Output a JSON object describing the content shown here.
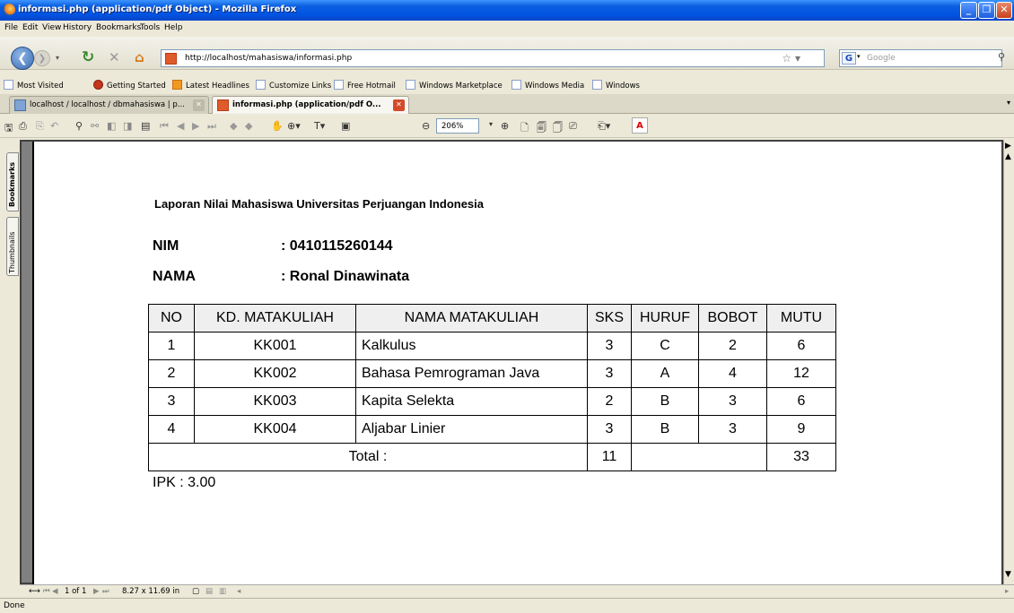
{
  "window": {
    "title": "informasi.php (application/pdf Object) - Mozilla Firefox"
  },
  "menu": [
    "File",
    "Edit",
    "View",
    "History",
    "Bookmarks",
    "Tools",
    "Help"
  ],
  "nav": {
    "url": "http://localhost/mahasiswa/informasi.php",
    "search_placeholder": "Google"
  },
  "bookmarks": [
    "Most Visited",
    "Getting Started",
    "Latest Headlines",
    "Customize Links",
    "Free Hotmail",
    "Windows Marketplace",
    "Windows Media",
    "Windows"
  ],
  "tabs": [
    {
      "label": "localhost / localhost / dbmahasiswa | p..."
    },
    {
      "label": "informasi.php (application/pdf O..."
    }
  ],
  "pdf_toolbar": {
    "zoom": "206%"
  },
  "sidebar_tabs": [
    "Bookmarks",
    "Thumbnails"
  ],
  "report": {
    "title": "Laporan Nilai Mahasiswa Universitas Perjuangan Indonesia",
    "nim_label": "NIM",
    "nim_value": ": 0410115260144",
    "nama_label": "NAMA",
    "nama_value": ": Ronal Dinawinata",
    "headers": [
      "NO",
      "KD. MATAKULIAH",
      "NAMA MATAKULIAH",
      "SKS",
      "HURUF",
      "BOBOT",
      "MUTU"
    ],
    "rows": [
      [
        "1",
        "KK001",
        "Kalkulus",
        "3",
        "C",
        "2",
        "6"
      ],
      [
        "2",
        "KK002",
        "Bahasa Pemrograman Java",
        "3",
        "A",
        "4",
        "12"
      ],
      [
        "3",
        "KK003",
        "Kapita Selekta",
        "2",
        "B",
        "3",
        "6"
      ],
      [
        "4",
        "KK004",
        "Aljabar Linier",
        "3",
        "B",
        "3",
        "9"
      ]
    ],
    "total_label": "Total :",
    "total_sks": "11",
    "total_mutu": "33",
    "ipk": "IPK : 3.00"
  },
  "pdf_status": {
    "page": "1 of 1",
    "page_size": "8.27 x 11.69 in"
  },
  "status": "Done"
}
